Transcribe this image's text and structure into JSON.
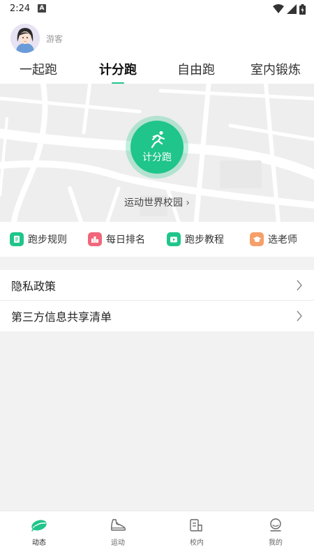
{
  "status_bar": {
    "time": "2:24",
    "notification_glyph": "A"
  },
  "user": {
    "name": "游客"
  },
  "tabs": [
    {
      "label": "一起跑"
    },
    {
      "label": "计分跑"
    },
    {
      "label": "自由跑"
    },
    {
      "label": "室内锻炼"
    }
  ],
  "active_tab": "计分跑",
  "map": {
    "run_button_label": "计分跑",
    "campus_label": "运动世界校园",
    "campus_chevron": "›"
  },
  "quick_actions": [
    {
      "label": "跑步规则",
      "icon": "rules-icon",
      "color": "#1fc58a"
    },
    {
      "label": "每日排名",
      "icon": "ranking-icon",
      "color": "#f0677a"
    },
    {
      "label": "跑步教程",
      "icon": "tutorial-icon",
      "color": "#1fc58a"
    },
    {
      "label": "选老师",
      "icon": "teacher-icon",
      "color": "#f5a06a"
    }
  ],
  "menu": [
    {
      "label": "隐私政策"
    },
    {
      "label": "第三方信息共享清单"
    }
  ],
  "bottom_nav": [
    {
      "label": "动态",
      "icon": "feed-icon"
    },
    {
      "label": "运动",
      "icon": "shoe-icon"
    },
    {
      "label": "校内",
      "icon": "campus-icon"
    },
    {
      "label": "我的",
      "icon": "profile-icon"
    }
  ],
  "active_nav": "动态",
  "colors": {
    "accent": "#1fc58a",
    "background": "#f2f2f2"
  }
}
